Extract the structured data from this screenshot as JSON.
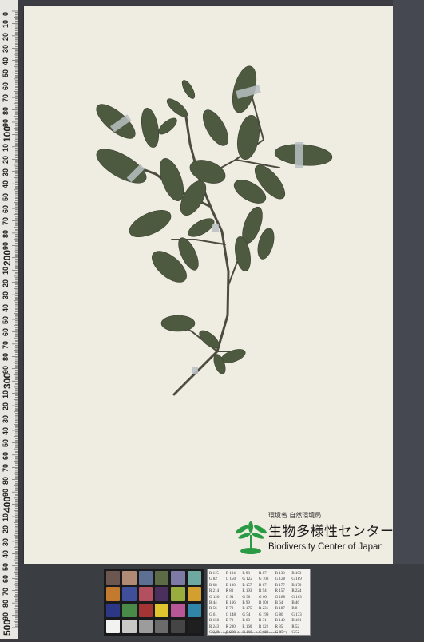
{
  "ruler": {
    "labels": [
      "0",
      "10",
      "20",
      "30",
      "40",
      "50",
      "60",
      "70",
      "80",
      "90",
      "100",
      "10",
      "20",
      "30",
      "40",
      "50",
      "60",
      "70",
      "80",
      "90",
      "200",
      "10",
      "20",
      "30",
      "40",
      "50",
      "60",
      "70",
      "80",
      "90",
      "300",
      "10",
      "20",
      "30",
      "40",
      "50",
      "60",
      "70",
      "80",
      "90",
      "400",
      "10",
      "20",
      "30",
      "40",
      "50",
      "60",
      "70",
      "80",
      "90",
      "500"
    ]
  },
  "logo": {
    "org_jp_small": "環境省 自然環境局",
    "name_jp": "生物多様性センター",
    "name_en": "Biodiversity Center of Japan"
  },
  "color_card": {
    "patches": [
      "#6b574f",
      "#b08a74",
      "#5d6f93",
      "#5c6b45",
      "#7d7aa6",
      "#6fa8a0",
      "#c27a2f",
      "#3f4f9a",
      "#b2505f",
      "#4b2f5d",
      "#98ad3d",
      "#d3a02f",
      "#2c3785",
      "#4a8a48",
      "#a53434",
      "#e0c42f",
      "#b85797",
      "#2f86a8",
      "#f2f2f0",
      "#c9c9c8",
      "#9c9c9c",
      "#6b6b6b",
      "#454545",
      "#1f1f1f"
    ],
    "table_cells": [
      "R 115",
      "R 194",
      "R 98",
      "R 87",
      "R 133",
      "R 103",
      "G 82",
      "G 150",
      "G 122",
      "G 108",
      "G 128",
      "G 189",
      "B 68",
      "B 130",
      "B 157",
      "B 67",
      "B 177",
      "B 170",
      "R 214",
      "R 80",
      "R 193",
      "R 94",
      "R 157",
      "R 224",
      "G 126",
      "G 91",
      "G 90",
      "G 60",
      "G 188",
      "G 163",
      "B 44",
      "B 166",
      "B 99",
      "B 108",
      "B 64",
      "B 46",
      "R 56",
      "R 70",
      "R 175",
      "R 231",
      "R 187",
      "R 8",
      "G 61",
      "G 148",
      "G 54",
      "G 199",
      "G 86",
      "G 133",
      "B 150",
      "B 73",
      "B 60",
      "B 31",
      "B 149",
      "B 161",
      "R 243",
      "R 200",
      "R 160",
      "R 122",
      "R 85",
      "R 52",
      "G 243",
      "G 200",
      "G 160",
      "G 122",
      "G 85",
      "G 52",
      "B 242",
      "B 200",
      "B 160",
      "B 121",
      "B 85",
      "B 52"
    ],
    "caption": "by GretagMacbeth color checker (Illuminant C 2°)"
  }
}
